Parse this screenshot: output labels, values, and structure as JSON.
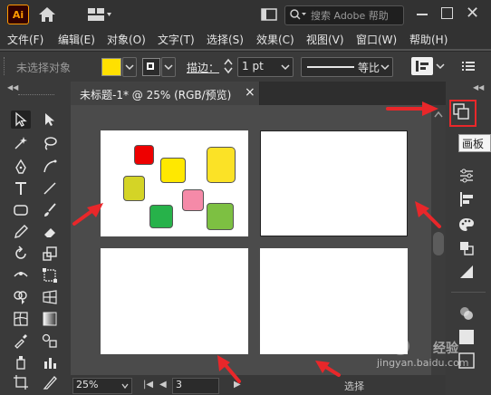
{
  "titlebar": {
    "app_logo": "Ai",
    "search_placeholder": "搜索 Adobe 帮助"
  },
  "menu": {
    "items": [
      "文件(F)",
      "编辑(E)",
      "对象(O)",
      "文字(T)",
      "选择(S)",
      "效果(C)",
      "视图(V)",
      "窗口(W)",
      "帮助(H)"
    ]
  },
  "controlbar": {
    "selection_status": "未选择对象",
    "fill_color": "#ffe000",
    "stroke_label": "描边：",
    "stroke_value": "1 pt",
    "profile_label": "等比"
  },
  "document": {
    "tab_title": "未标题-1* @ 25% (RGB/预览)",
    "close_glyph": "×"
  },
  "statusbar": {
    "zoom": "25%",
    "page": "3",
    "tool_name": "选择"
  },
  "rightpanel": {
    "artboard_tooltip": "画板"
  },
  "watermark": {
    "text_top": "经验",
    "text_bottom": "jingyan.baidu.com"
  },
  "colors": {
    "annotation_red": "#e8272a",
    "accent_highlight": "#e8272a"
  }
}
